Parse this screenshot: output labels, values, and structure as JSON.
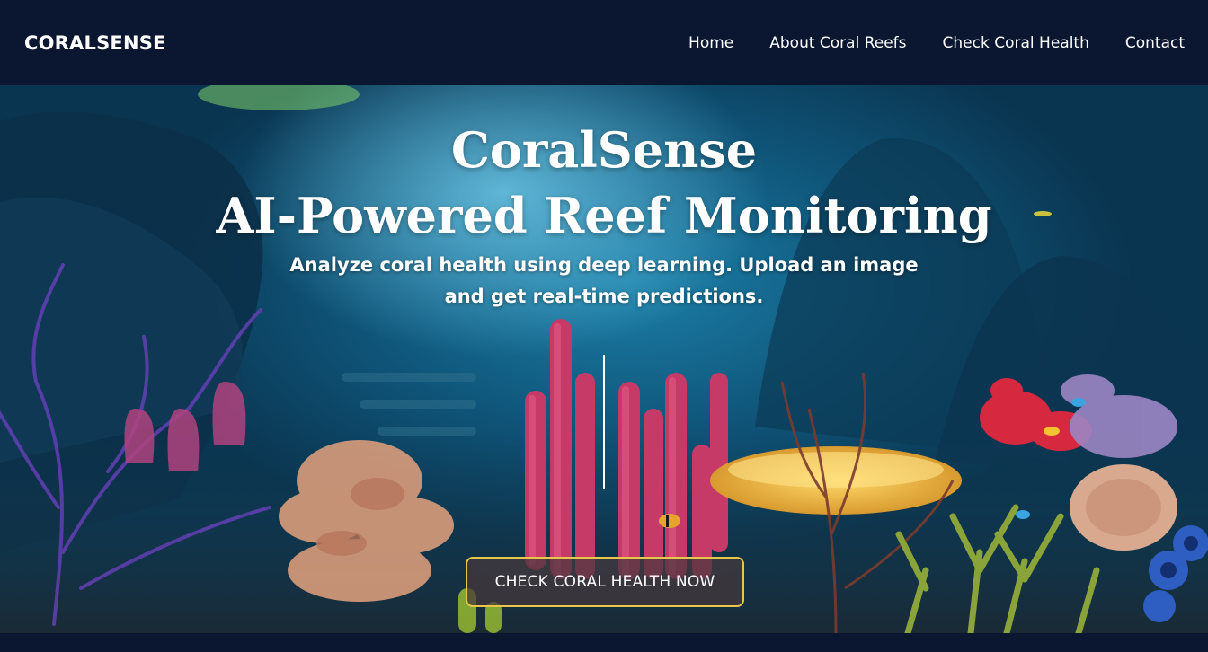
{
  "brand": {
    "name": "CORALSENSE"
  },
  "nav": {
    "items": [
      {
        "label": "Home"
      },
      {
        "label": "About Coral Reefs"
      },
      {
        "label": "Check Coral Health"
      },
      {
        "label": "Contact"
      }
    ]
  },
  "hero": {
    "title_line1": "CoralSense",
    "title_line2": "AI-Powered Reef Monitoring",
    "subtitle": "Analyze coral health using deep learning. Upload an image and get real-time predictions.",
    "cta_label": "CHECK CORAL HEALTH NOW",
    "background": "underwater-coral-reef-image"
  },
  "colors": {
    "navbar_bg": "#0b1730",
    "cta_border": "#e8c64a",
    "text": "#ffffff"
  }
}
